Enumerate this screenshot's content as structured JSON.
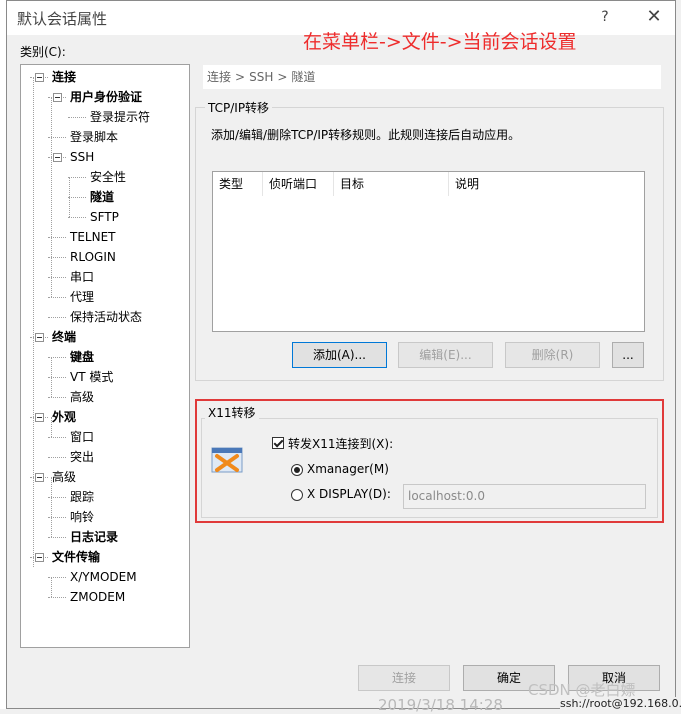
{
  "window": {
    "title": "默认会话属性",
    "help_label": "?",
    "close_label": "✕"
  },
  "annotation": "在菜单栏->文件->当前会话设置",
  "category_label": "类别(C):",
  "tree": [
    {
      "label": "连接",
      "bold": true,
      "level": 0,
      "expander": true
    },
    {
      "label": "用户身份验证",
      "bold": true,
      "level": 1,
      "expander": true
    },
    {
      "label": "登录提示符",
      "bold": false,
      "level": 2,
      "expander": false
    },
    {
      "label": "登录脚本",
      "bold": false,
      "level": 1,
      "expander": false
    },
    {
      "label": "SSH",
      "bold": false,
      "level": 1,
      "expander": true
    },
    {
      "label": "安全性",
      "bold": false,
      "level": 2,
      "expander": false
    },
    {
      "label": "隧道",
      "bold": true,
      "level": 2,
      "expander": false
    },
    {
      "label": "SFTP",
      "bold": false,
      "level": 2,
      "expander": false
    },
    {
      "label": "TELNET",
      "bold": false,
      "level": 1,
      "expander": false
    },
    {
      "label": "RLOGIN",
      "bold": false,
      "level": 1,
      "expander": false
    },
    {
      "label": "串口",
      "bold": false,
      "level": 1,
      "expander": false
    },
    {
      "label": "代理",
      "bold": false,
      "level": 1,
      "expander": false
    },
    {
      "label": "保持活动状态",
      "bold": false,
      "level": 1,
      "expander": false
    },
    {
      "label": "终端",
      "bold": true,
      "level": 0,
      "expander": true
    },
    {
      "label": "键盘",
      "bold": true,
      "level": 1,
      "expander": false
    },
    {
      "label": "VT 模式",
      "bold": false,
      "level": 1,
      "expander": false
    },
    {
      "label": "高级",
      "bold": false,
      "level": 1,
      "expander": false
    },
    {
      "label": "外观",
      "bold": true,
      "level": 0,
      "expander": true
    },
    {
      "label": "窗口",
      "bold": false,
      "level": 1,
      "expander": false
    },
    {
      "label": "突出",
      "bold": false,
      "level": 1,
      "expander": false
    },
    {
      "label": "高级",
      "bold": false,
      "level": 0,
      "expander": true
    },
    {
      "label": "跟踪",
      "bold": false,
      "level": 1,
      "expander": false
    },
    {
      "label": "响铃",
      "bold": false,
      "level": 1,
      "expander": false
    },
    {
      "label": "日志记录",
      "bold": true,
      "level": 1,
      "expander": false
    },
    {
      "label": "文件传输",
      "bold": true,
      "level": 0,
      "expander": true
    },
    {
      "label": "X/YMODEM",
      "bold": false,
      "level": 1,
      "expander": false
    },
    {
      "label": "ZMODEM",
      "bold": false,
      "level": 1,
      "expander": false
    }
  ],
  "breadcrumb": [
    "连接",
    "SSH",
    "隧道"
  ],
  "breadcrumb_sep": ">",
  "tcpip": {
    "title": "TCP/IP转移",
    "description": "添加/编辑/删除TCP/IP转移规则。此规则连接后自动应用。",
    "columns": [
      "类型",
      "侦听端口",
      "目标",
      "说明"
    ],
    "add_label": "添加(A)...",
    "edit_label": "编辑(E)...",
    "delete_label": "删除(R)",
    "more_label": "..."
  },
  "x11": {
    "title": "X11转移",
    "forward_label": "转发X11连接到(X):",
    "forward_checked": true,
    "xmanager_label": "Xmanager(M)",
    "xdisplay_label": "X DISPLAY(D):",
    "xdisplay_value": "localhost:0.0",
    "selected": "xmanager"
  },
  "footer": {
    "connect_label": "连接",
    "ok_label": "确定",
    "cancel_label": "取消"
  },
  "watermark": "CSDN @老白嫖",
  "background_text": "2019/3/18 14:28",
  "status_text": "ssh://root@192.168.0."
}
